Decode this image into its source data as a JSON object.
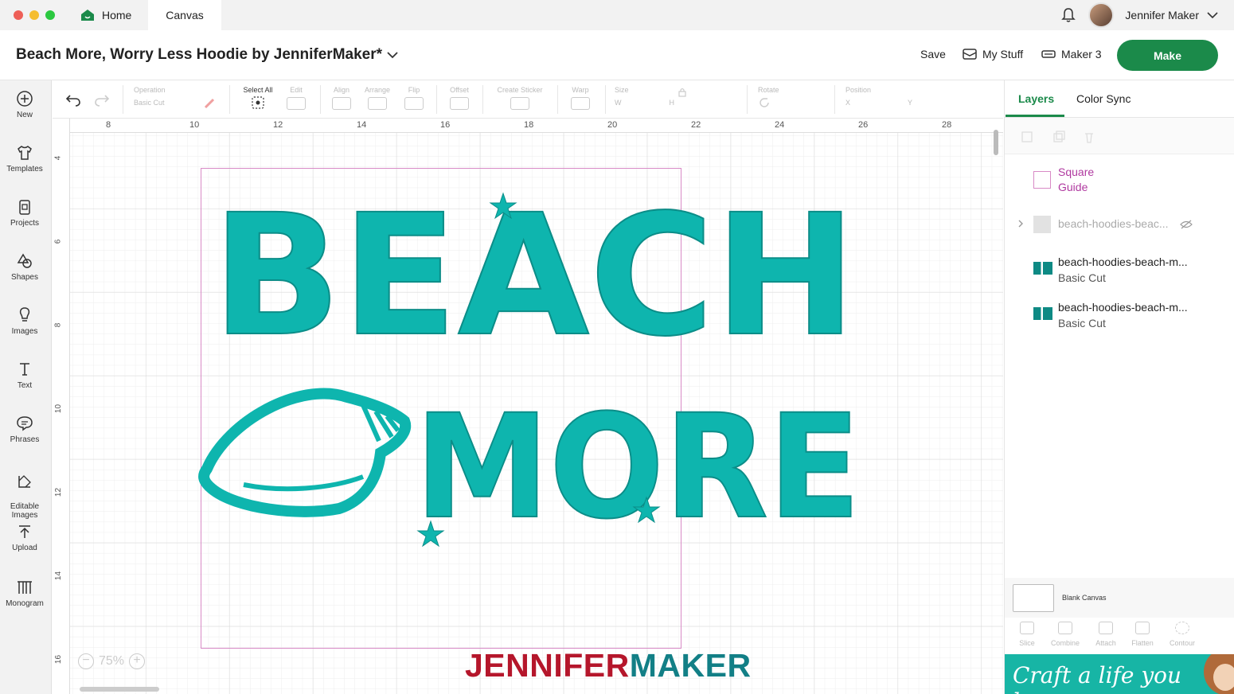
{
  "window": {
    "tabs": [
      {
        "label": "Home"
      },
      {
        "label": "Canvas"
      }
    ],
    "user_name": "Jennifer Maker"
  },
  "header": {
    "title": "Beach More, Worry Less Hoodie by JenniferMaker*",
    "save_label": "Save",
    "my_stuff_label": "My Stuff",
    "machine_label": "Maker 3",
    "make_label": "Make"
  },
  "sidebar": {
    "items": [
      {
        "label": "New",
        "icon": "plus-circle-icon"
      },
      {
        "label": "Templates",
        "icon": "shirt-icon"
      },
      {
        "label": "Projects",
        "icon": "clipboard-icon"
      },
      {
        "label": "Shapes",
        "icon": "shapes-icon"
      },
      {
        "label": "Images",
        "icon": "lightbulb-icon"
      },
      {
        "label": "Text",
        "icon": "text-icon"
      },
      {
        "label": "Phrases",
        "icon": "speech-bubble-icon"
      },
      {
        "label": "Editable\nImages",
        "icon": "editable-image-icon"
      },
      {
        "label": "Upload",
        "icon": "upload-icon"
      },
      {
        "label": "Monogram",
        "icon": "monogram-icon"
      }
    ]
  },
  "toolbar": {
    "operation_label": "Operation",
    "operation_value": "Basic Cut",
    "select_all_label": "Select All",
    "edit_label": "Edit",
    "align_label": "Align",
    "arrange_label": "Arrange",
    "flip_label": "Flip",
    "offset_label": "Offset",
    "create_sticker_label": "Create Sticker",
    "warp_label": "Warp",
    "size_label": "Size",
    "size_w": "W",
    "size_h": "H",
    "rotate_label": "Rotate",
    "position_label": "Position",
    "pos_x": "X",
    "pos_y": "Y"
  },
  "canvas": {
    "ruler_top": [
      "8",
      "10",
      "12",
      "14",
      "16",
      "18",
      "20",
      "22",
      "24",
      "26",
      "28"
    ],
    "ruler_left": [
      "4",
      "6",
      "8",
      "10",
      "12",
      "14",
      "16"
    ],
    "zoom": "75%",
    "design_line1": "BEACH",
    "design_line2": "MORE",
    "design_color": "#0eb5ae",
    "watermark_part1": "JENNIFER",
    "watermark_part2": "MAKER",
    "watermark_color1": "#b5162b",
    "watermark_color2": "#127f86"
  },
  "panel": {
    "tab_layers": "Layers",
    "tab_color_sync": "Color Sync",
    "layers": [
      {
        "name": "Square",
        "sub": "Guide"
      },
      {
        "name": "beach-hoodies-beac..."
      },
      {
        "name": "beach-hoodies-beach-m...",
        "sub": "Basic Cut"
      },
      {
        "name": "beach-hoodies-beach-m...",
        "sub": "Basic Cut"
      }
    ],
    "blank_canvas_label": "Blank Canvas",
    "bottom_tools": [
      "Slice",
      "Combine",
      "Attach",
      "Flatten",
      "Contour"
    ],
    "banner_text": "Craft a life you love"
  }
}
